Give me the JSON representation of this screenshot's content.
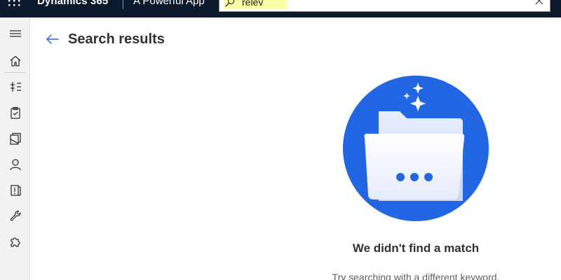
{
  "header": {
    "brand": "Dynamics 365",
    "app_name": "A Powerful App",
    "search": {
      "value": "relev",
      "highlight_color": "#f7ffa6"
    },
    "background_color": "#0c1a2e",
    "icons": {
      "launcher": "waffle-icon",
      "search": "search-icon",
      "clear": "close-icon"
    }
  },
  "sidebar": {
    "items": [
      {
        "icon": "hamburger-menu-icon"
      },
      {
        "icon": "home-icon"
      },
      {
        "icon": "pin-icon"
      },
      {
        "icon": "clipboard-icon"
      },
      {
        "icon": "documents-icon"
      },
      {
        "icon": "person-icon"
      },
      {
        "icon": "alert-icon"
      },
      {
        "icon": "wrench-icon"
      },
      {
        "icon": "puzzle-icon"
      }
    ]
  },
  "main": {
    "title": "Search results",
    "back_icon": "arrow-left-icon",
    "empty_state": {
      "title": "We didn't find a match",
      "subtitle": "Try searching with a different keyword.",
      "illustration": "folder-illustration",
      "accent_color": "#2266e3"
    }
  }
}
